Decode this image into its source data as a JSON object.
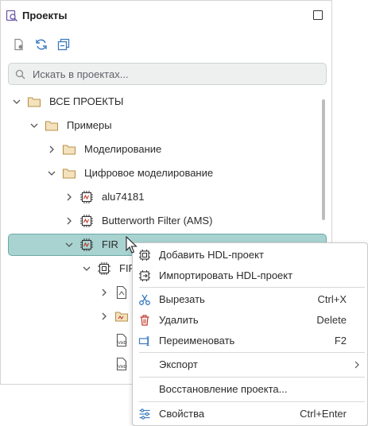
{
  "window": {
    "title": "Проекты"
  },
  "search": {
    "placeholder": "Искать в проектах..."
  },
  "tree": {
    "items": [
      {
        "label": "ВСЕ ПРОЕКТЫ",
        "icon": "folder-icon",
        "expanded": true
      },
      {
        "label": "Примеры",
        "icon": "folder-icon",
        "expanded": true
      },
      {
        "label": "Моделирование",
        "icon": "folder-icon",
        "expanded": false
      },
      {
        "label": "Цифровое моделирование",
        "icon": "folder-icon",
        "expanded": true
      },
      {
        "label": "alu74181",
        "icon": "chip-project-icon",
        "expanded": false
      },
      {
        "label": "Butterworth Filter  (AMS)",
        "icon": "chip-project-icon",
        "expanded": false
      },
      {
        "label": "FIR",
        "icon": "chip-project-icon",
        "expanded": true
      },
      {
        "label": "FIR",
        "icon": "chip-icon",
        "expanded": true
      },
      {
        "label": "",
        "icon": "document-icon",
        "expanded": false
      },
      {
        "label": "",
        "icon": "folder-wave-icon",
        "expanded": false
      },
      {
        "label": "",
        "icon": "vhd-file-icon"
      },
      {
        "label": "",
        "icon": "vhd-file-icon"
      }
    ]
  },
  "context_menu": {
    "items": [
      {
        "label": "Добавить HDL-проект",
        "shortcut": "",
        "icon": "chip-add-icon"
      },
      {
        "label": "Импортировать HDL-проект",
        "shortcut": "",
        "icon": "chip-import-icon"
      },
      {
        "label": "Вырезать",
        "shortcut": "Ctrl+X",
        "icon": "scissors-icon"
      },
      {
        "label": "Удалить",
        "shortcut": "Delete",
        "icon": "trash-icon"
      },
      {
        "label": "Переименовать",
        "shortcut": "F2",
        "icon": "rename-icon"
      },
      {
        "label": "Экспорт",
        "shortcut": "",
        "icon": ""
      },
      {
        "label": "Восстановление проекта...",
        "shortcut": "",
        "icon": ""
      },
      {
        "label": "Свойства",
        "shortcut": "Ctrl+Enter",
        "icon": "properties-icon"
      }
    ]
  },
  "colors": {
    "selection": "#a8d3d1",
    "accent": "#3b7bbf",
    "danger": "#c0392b"
  }
}
